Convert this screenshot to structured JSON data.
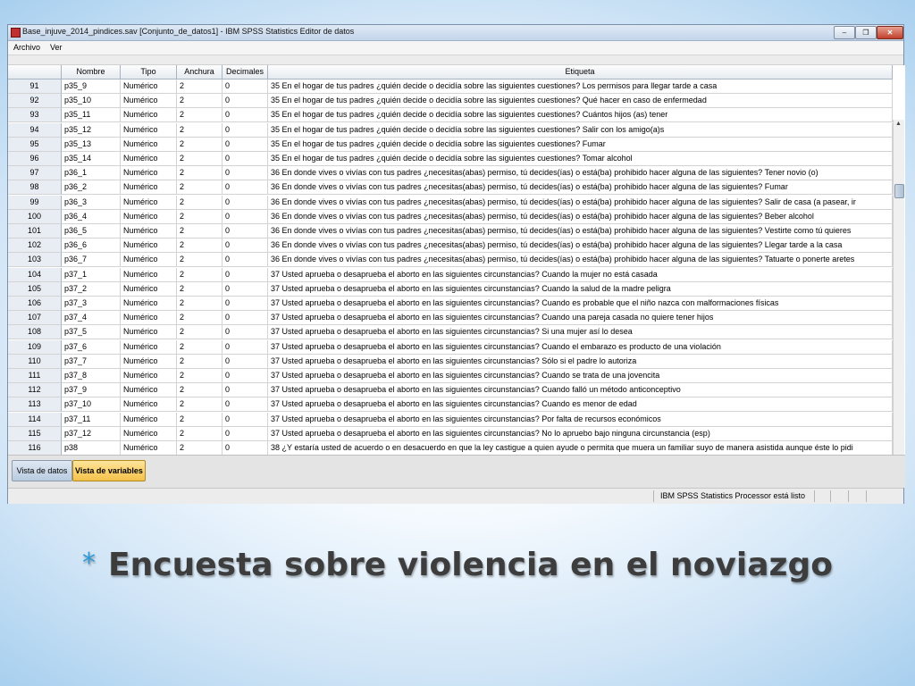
{
  "window": {
    "title": "Base_injuve_2014_pindices.sav [Conjunto_de_datos1] - IBM SPSS Statistics Editor de datos",
    "controls": [
      "–",
      "❐",
      "✕"
    ]
  },
  "menu": [
    "Archivo",
    "Ver"
  ],
  "columns": [
    "",
    "Nombre",
    "Tipo",
    "Anchura",
    "Decimales",
    "Etiqueta"
  ],
  "rows": [
    {
      "n": "91",
      "name": "p35_9",
      "type": "Numérico",
      "width": "2",
      "dec": "0",
      "label": "35 En el hogar de tus padres ¿quién decide o decidía sobre las siguientes cuestiones? Los permisos para llegar tarde a casa"
    },
    {
      "n": "92",
      "name": "p35_10",
      "type": "Numérico",
      "width": "2",
      "dec": "0",
      "label": "35 En el hogar de tus padres ¿quién decide o decidía sobre las siguientes cuestiones? Qué hacer en caso de  enfermedad"
    },
    {
      "n": "93",
      "name": "p35_11",
      "type": "Numérico",
      "width": "2",
      "dec": "0",
      "label": "35 En el hogar de tus padres ¿quién decide o decidía sobre las siguientes cuestiones? Cuántos hijos (as) tener"
    },
    {
      "n": "94",
      "name": "p35_12",
      "type": "Numérico",
      "width": "2",
      "dec": "0",
      "label": "35 En el hogar de tus padres ¿quién decide o decidía sobre las siguientes cuestiones? Salir con los amigo(a)s"
    },
    {
      "n": "95",
      "name": "p35_13",
      "type": "Numérico",
      "width": "2",
      "dec": "0",
      "label": "35 En el hogar de tus padres ¿quién decide o decidía sobre las siguientes cuestiones? Fumar"
    },
    {
      "n": "96",
      "name": "p35_14",
      "type": "Numérico",
      "width": "2",
      "dec": "0",
      "label": "35 En el hogar de tus padres ¿quién decide o decidía sobre las siguientes cuestiones? Tomar alcohol"
    },
    {
      "n": "97",
      "name": "p36_1",
      "type": "Numérico",
      "width": "2",
      "dec": "0",
      "label": "36 En donde vives o vivías con tus padres ¿necesitas(abas) permiso, tú decides(ías) o está(ba) prohibido hacer alguna de las siguientes?  Tener novio (o)"
    },
    {
      "n": "98",
      "name": "p36_2",
      "type": "Numérico",
      "width": "2",
      "dec": "0",
      "label": "36 En donde vives o vivías con tus padres ¿necesitas(abas) permiso, tú decides(ías) o está(ba) prohibido hacer alguna de las siguientes?  Fumar"
    },
    {
      "n": "99",
      "name": "p36_3",
      "type": "Numérico",
      "width": "2",
      "dec": "0",
      "label": "36 En donde vives o vivías con tus padres ¿necesitas(abas) permiso, tú decides(ías) o está(ba) prohibido hacer alguna de las siguientes?  Salir de casa (a pasear, ir"
    },
    {
      "n": "100",
      "name": "p36_4",
      "type": "Numérico",
      "width": "2",
      "dec": "0",
      "label": "36 En donde vives o vivías con tus padres ¿necesitas(abas) permiso, tú decides(ías) o está(ba) prohibido hacer alguna de las siguientes?  Beber alcohol"
    },
    {
      "n": "101",
      "name": "p36_5",
      "type": "Numérico",
      "width": "2",
      "dec": "0",
      "label": "36 En donde vives o vivías con tus padres ¿necesitas(abas) permiso, tú decides(ías) o está(ba) prohibido hacer alguna de las siguientes?  Vestirte como tú quieres"
    },
    {
      "n": "102",
      "name": "p36_6",
      "type": "Numérico",
      "width": "2",
      "dec": "0",
      "label": "36 En donde vives o vivías con tus padres ¿necesitas(abas) permiso, tú decides(ías) o está(ba) prohibido hacer alguna de las siguientes?  Llegar tarde a la casa"
    },
    {
      "n": "103",
      "name": "p36_7",
      "type": "Numérico",
      "width": "2",
      "dec": "0",
      "label": "36 En donde vives o vivías con tus padres ¿necesitas(abas) permiso, tú decides(ías) o está(ba) prohibido hacer alguna de las siguientes?  Tatuarte o ponerte aretes"
    },
    {
      "n": "104",
      "name": "p37_1",
      "type": "Numérico",
      "width": "2",
      "dec": "0",
      "label": "37 Usted aprueba o desaprueba el aborto en las siguientes circunstancias?  Cuando la mujer no está casada"
    },
    {
      "n": "105",
      "name": "p37_2",
      "type": "Numérico",
      "width": "2",
      "dec": "0",
      "label": "37 Usted aprueba o desaprueba el aborto en las siguientes circunstancias?  Cuando la salud de la madre peligra"
    },
    {
      "n": "106",
      "name": "p37_3",
      "type": "Numérico",
      "width": "2",
      "dec": "0",
      "label": "37 Usted aprueba o desaprueba el aborto en las siguientes circunstancias?  Cuando es probable que el niño nazca con malformaciones físicas"
    },
    {
      "n": "107",
      "name": "p37_4",
      "type": "Numérico",
      "width": "2",
      "dec": "0",
      "label": "37 Usted aprueba o desaprueba el aborto en las siguientes circunstancias?  Cuando una pareja casada no quiere tener hijos"
    },
    {
      "n": "108",
      "name": "p37_5",
      "type": "Numérico",
      "width": "2",
      "dec": "0",
      "label": "37 Usted aprueba o desaprueba el aborto en las siguientes circunstancias?  Si una mujer así lo desea"
    },
    {
      "n": "109",
      "name": "p37_6",
      "type": "Numérico",
      "width": "2",
      "dec": "0",
      "label": "37 Usted aprueba o desaprueba el aborto en las siguientes circunstancias?  Cuando el embarazo es producto de una violación"
    },
    {
      "n": "110",
      "name": "p37_7",
      "type": "Numérico",
      "width": "2",
      "dec": "0",
      "label": "37 Usted aprueba o desaprueba el aborto en las siguientes circunstancias?  Sólo si el padre lo autoriza"
    },
    {
      "n": "111",
      "name": "p37_8",
      "type": "Numérico",
      "width": "2",
      "dec": "0",
      "label": "37 Usted aprueba o desaprueba el aborto en las siguientes circunstancias?  Cuando se trata de una jovencita"
    },
    {
      "n": "112",
      "name": "p37_9",
      "type": "Numérico",
      "width": "2",
      "dec": "0",
      "label": "37 Usted aprueba o desaprueba el aborto en las siguientes circunstancias?  Cuando falló un método anticonceptivo"
    },
    {
      "n": "113",
      "name": "p37_10",
      "type": "Numérico",
      "width": "2",
      "dec": "0",
      "label": "37 Usted aprueba o desaprueba el aborto en las siguientes circunstancias?  Cuando es menor de edad"
    },
    {
      "n": "114",
      "name": "p37_11",
      "type": "Numérico",
      "width": "2",
      "dec": "0",
      "label": "37 Usted aprueba o desaprueba el aborto en las siguientes circunstancias?  Por falta de recursos económicos"
    },
    {
      "n": "115",
      "name": "p37_12",
      "type": "Numérico",
      "width": "2",
      "dec": "0",
      "label": "37 Usted aprueba o desaprueba el aborto en las siguientes circunstancias?  No lo apruebo bajo ninguna circunstancia (esp)"
    },
    {
      "n": "116",
      "name": "p38",
      "type": "Numérico",
      "width": "2",
      "dec": "0",
      "label": "38 ¿Y estaría usted de acuerdo o en desacuerdo en que la ley castigue a quien ayude o permita que muera un familiar suyo de manera asistida aunque éste lo pidi"
    }
  ],
  "tabs": {
    "data_view": "Vista de datos",
    "variable_view": "Vista de variables"
  },
  "status": "IBM SPSS Statistics Processor está listo",
  "slide": {
    "bullet": "*",
    "title": "Encuesta sobre violencia en el noviazgo"
  }
}
